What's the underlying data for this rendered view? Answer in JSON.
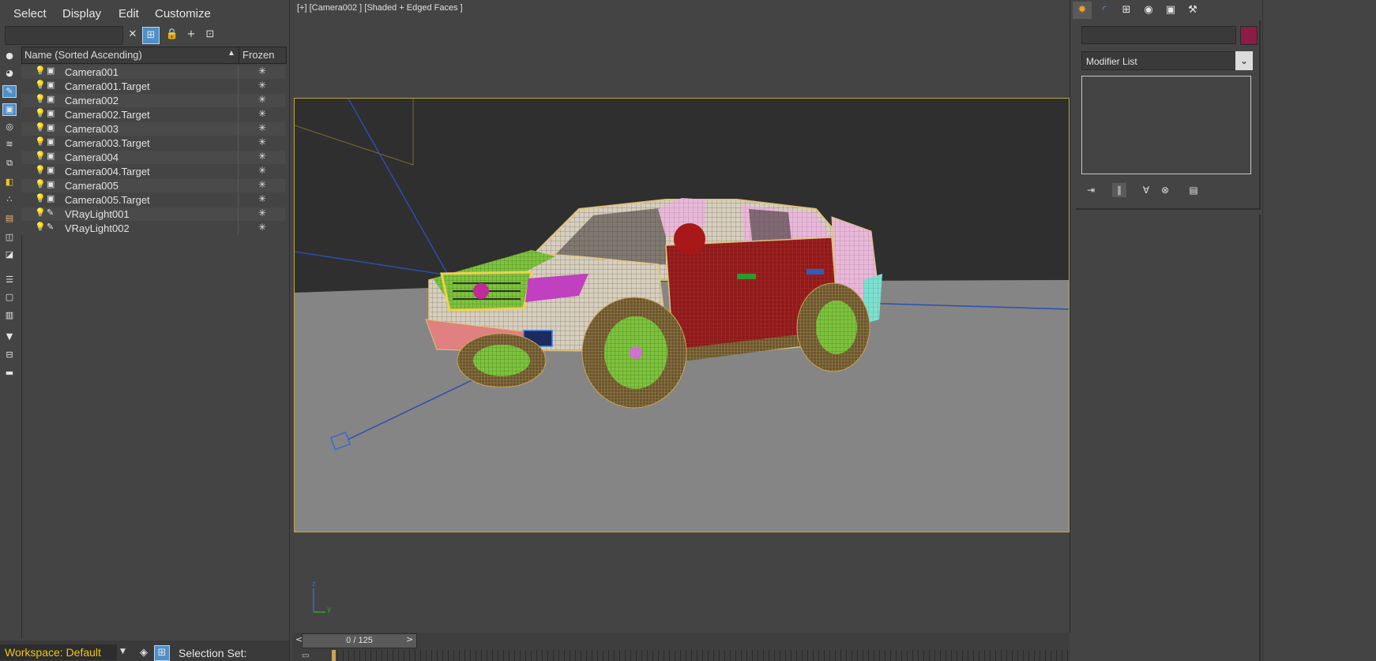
{
  "menu": [
    "Select",
    "Display",
    "Edit",
    "Customize"
  ],
  "explorer": {
    "columns": {
      "name": "Name (Sorted Ascending)",
      "frozen": "Frozen"
    },
    "rows": [
      {
        "name": "Camera001",
        "type": "camera"
      },
      {
        "name": "Camera001.Target",
        "type": "camera"
      },
      {
        "name": "Camera002",
        "type": "camera"
      },
      {
        "name": "Camera002.Target",
        "type": "camera"
      },
      {
        "name": "Camera003",
        "type": "camera"
      },
      {
        "name": "Camera003.Target",
        "type": "camera"
      },
      {
        "name": "Camera004",
        "type": "camera"
      },
      {
        "name": "Camera004.Target",
        "type": "camera"
      },
      {
        "name": "Camera005",
        "type": "camera"
      },
      {
        "name": "Camera005.Target",
        "type": "camera"
      },
      {
        "name": "VRayLight001",
        "type": "light"
      },
      {
        "name": "VRayLight002",
        "type": "light"
      }
    ],
    "workspace": "Workspace: Default",
    "selection_set": "Selection Set:"
  },
  "viewport": {
    "label": "[+] [Camera002 ] [Shaded + Edged Faces ]",
    "axis_z": "z",
    "axis_y": "y"
  },
  "timeline": {
    "frame": "0 / 125",
    "prev": "<",
    "next": ">"
  },
  "command_panel": {
    "modifier_list": "Modifier List",
    "object_color": "#8a1c46"
  },
  "icons": {
    "bulb": "light-bulb-icon",
    "frozen": "snowflake-icon"
  }
}
